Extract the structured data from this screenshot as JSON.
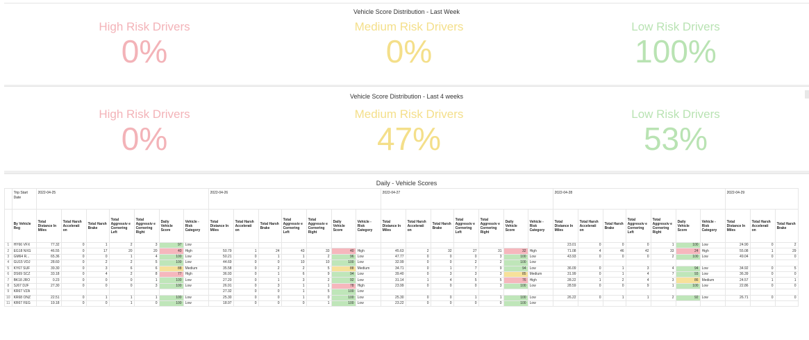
{
  "colors": {
    "high": "#f3b3b8",
    "medium": "#f4df8a",
    "low": "#b9e3b3"
  },
  "panel_week": {
    "title": "Vehicle Score Distribution - Last Week",
    "kpis": [
      {
        "label": "High Risk Drivers",
        "value": "0%"
      },
      {
        "label": "Medium Risk Drivers",
        "value": "0%"
      },
      {
        "label": "Low Risk Drivers",
        "value": "100%"
      }
    ]
  },
  "panel_4weeks": {
    "title": "Vehicle Score Distribution - Last 4 weeks",
    "kpis": [
      {
        "label": "High Risk Drivers",
        "value": "0%"
      },
      {
        "label": "Medium Risk Drivers",
        "value": "47%"
      },
      {
        "label": "Low Risk Drivers",
        "value": "53%"
      }
    ]
  },
  "table": {
    "title": "Daily - Vehicle Scores",
    "trip_start_label": "Trip Start Date",
    "by_vehicle_label": "By Vehicle Reg",
    "dates": [
      "2022-04-25",
      "2022-04-26",
      "2022-04-27",
      "2022-04-28",
      "2022-04-29"
    ],
    "columns": [
      "Total Distance In Miles",
      "Total Harsh Accelerati on",
      "Total Harsh Brake",
      "Total Aggressiv e Cornering Left",
      "Total Aggressiv e Cornering Right",
      "Daily Vehicle Score",
      "Vehicle - Risk Category"
    ],
    "rows": [
      {
        "idx": "1",
        "reg": "HY66 VFX",
        "d1": [
          "77.32",
          "0",
          "1",
          "2",
          "3",
          "97",
          "Low"
        ],
        "d2": [
          "",
          "",
          "",
          "",
          "",
          "",
          ""
        ],
        "d3": [
          "",
          "",
          "",
          "",
          "",
          "",
          ""
        ],
        "d4": [
          "23.01",
          "0",
          "0",
          "0",
          "1",
          "100",
          "Low"
        ],
        "d5": [
          "24.90",
          "0",
          "2"
        ]
      },
      {
        "idx": "2",
        "reg": "EG18 NXG",
        "d1": [
          "46.55",
          "0",
          "17",
          "20",
          "20",
          "40",
          "High"
        ],
        "d2": [
          "50.79",
          "1",
          "24",
          "43",
          "33",
          "40",
          "High"
        ],
        "d3": [
          "45.63",
          "2",
          "32",
          "27",
          "31",
          "32",
          "High"
        ],
        "d4": [
          "71.08",
          "4",
          "46",
          "42",
          "33",
          "24",
          "High"
        ],
        "d5": [
          "55.08",
          "1",
          "29"
        ]
      },
      {
        "idx": "3",
        "reg": "GM64 R...",
        "d1": [
          "65.36",
          "0",
          "0",
          "1",
          "4",
          "100",
          "Low"
        ],
        "d2": [
          "50.21",
          "0",
          "1",
          "1",
          "2",
          "96",
          "Low"
        ],
        "d3": [
          "47.77",
          "0",
          "0",
          "0",
          "3",
          "100",
          "Low"
        ],
        "d4": [
          "43.93",
          "0",
          "0",
          "0",
          "2",
          "100",
          "Low"
        ],
        "d5": [
          "49.04",
          "0",
          "0"
        ]
      },
      {
        "idx": "4",
        "reg": "GU15 VDJ",
        "d1": [
          "28.60",
          "0",
          "2",
          "2",
          "5",
          "100",
          "Low"
        ],
        "d2": [
          "44.69",
          "0",
          "0",
          "10",
          "10",
          "100",
          "Low"
        ],
        "d3": [
          "32.99",
          "0",
          "0",
          "2",
          "2",
          "100",
          "Low"
        ],
        "d4": [
          "",
          "",
          "",
          "",
          "",
          "",
          ""
        ],
        "d5": [
          "",
          "",
          ""
        ]
      },
      {
        "idx": "5",
        "reg": "KY67 SUF",
        "d1": [
          "39.30",
          "0",
          "3",
          "6",
          "6",
          "88",
          "Medium"
        ],
        "d2": [
          "35.58",
          "0",
          "2",
          "2",
          "5",
          "88",
          "Medium"
        ],
        "d3": [
          "34.71",
          "0",
          "1",
          "7",
          "9",
          "94",
          "Low"
        ],
        "d4": [
          "36.09",
          "0",
          "1",
          "3",
          "4",
          "94",
          "Low"
        ],
        "d5": [
          "34.92",
          "0",
          "5"
        ]
      },
      {
        "idx": "6",
        "reg": "DS69 SCZ",
        "d1": [
          "33.18",
          "0",
          "4",
          "2",
          "8",
          "77",
          "High"
        ],
        "d2": [
          "36.93",
          "0",
          "1",
          "6",
          "9",
          "94",
          "Low"
        ],
        "d3": [
          "39.40",
          "0",
          "3",
          "3",
          "3",
          "85",
          "Medium"
        ],
        "d4": [
          "31.99",
          "0",
          "1",
          "4",
          "7",
          "93",
          "Low"
        ],
        "d5": [
          "36.39",
          "0",
          "0"
        ]
      },
      {
        "idx": "7",
        "reg": "BK18 JRO",
        "d1": [
          "0.23",
          "0",
          "0",
          "0",
          "1",
          "100",
          "Low"
        ],
        "d2": [
          "27.20",
          "0",
          "1",
          "3",
          "2",
          "92",
          "Low"
        ],
        "d3": [
          "31.14",
          "1",
          "4",
          "5",
          "5",
          "76",
          "High"
        ],
        "d4": [
          "28.22",
          "1",
          "2",
          "4",
          "3",
          "86",
          "Medium"
        ],
        "d5": [
          "24.57",
          "1",
          "1"
        ]
      },
      {
        "idx": "8",
        "reg": "SJ67 DJF",
        "d1": [
          "27.30",
          "0",
          "0",
          "0",
          "3",
          "100",
          "Low"
        ],
        "d2": [
          "26.91",
          "0",
          "3",
          "1",
          "1",
          "78",
          "High"
        ],
        "d3": [
          "23.99",
          "0",
          "0",
          "0",
          "3",
          "100",
          "Low"
        ],
        "d4": [
          "28.59",
          "0",
          "0",
          "9",
          "1",
          "100",
          "Low"
        ],
        "d5": [
          "22.86",
          "0",
          "0"
        ]
      },
      {
        "idx": "9",
        "reg": "KR67 VZA",
        "d1": [
          "",
          "",
          "",
          "",
          "",
          "",
          ""
        ],
        "d2": [
          "27.32",
          "0",
          "0",
          "1",
          "5",
          "100",
          "Low"
        ],
        "d3": [
          "",
          "",
          "",
          "",
          "",
          "",
          ""
        ],
        "d4": [
          "",
          "",
          "",
          "",
          "",
          "",
          ""
        ],
        "d5": [
          "",
          "",
          ""
        ]
      },
      {
        "idx": "10",
        "reg": "KR68 ONZ",
        "d1": [
          "22.51",
          "0",
          "1",
          "1",
          "1",
          "100",
          "Low"
        ],
        "d2": [
          "25.30",
          "0",
          "0",
          "1",
          "0",
          "100",
          "Low"
        ],
        "d3": [
          "25.30",
          "0",
          "0",
          "1",
          "1",
          "100",
          "Low"
        ],
        "d4": [
          "26.22",
          "0",
          "1",
          "1",
          "2",
          "92",
          "Low"
        ],
        "d5": [
          "26.71",
          "0",
          "0"
        ]
      },
      {
        "idx": "11",
        "reg": "KR67 FEG",
        "d1": [
          "19.18",
          "0",
          "0",
          "1",
          "0",
          "100",
          "Low"
        ],
        "d2": [
          "18.97",
          "0",
          "0",
          "0",
          "1",
          "100",
          "Low"
        ],
        "d3": [
          "23.22",
          "0",
          "0",
          "0",
          "0",
          "100",
          "Low"
        ],
        "d4": [
          "",
          "",
          "",
          "",
          "",
          "",
          ""
        ],
        "d5": [
          "",
          "",
          ""
        ]
      }
    ]
  }
}
